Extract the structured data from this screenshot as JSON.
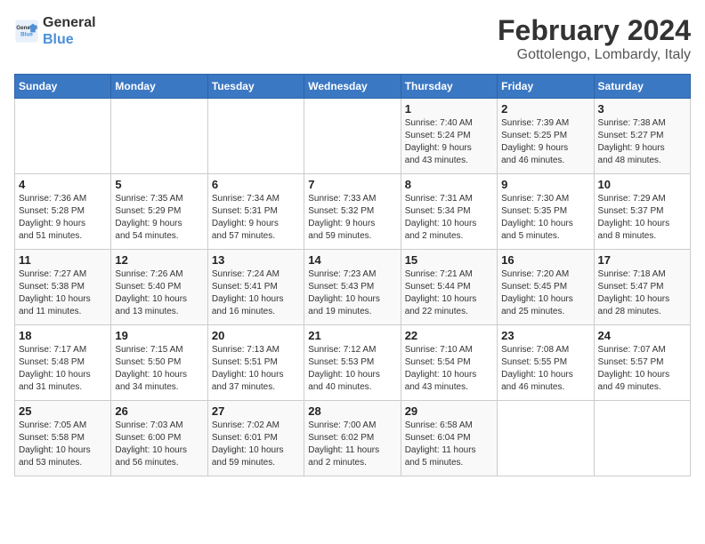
{
  "logo": {
    "line1": "General",
    "line2": "Blue"
  },
  "title": "February 2024",
  "location": "Gottolengo, Lombardy, Italy",
  "days_of_week": [
    "Sunday",
    "Monday",
    "Tuesday",
    "Wednesday",
    "Thursday",
    "Friday",
    "Saturday"
  ],
  "weeks": [
    [
      {
        "day": "",
        "info": ""
      },
      {
        "day": "",
        "info": ""
      },
      {
        "day": "",
        "info": ""
      },
      {
        "day": "",
        "info": ""
      },
      {
        "day": "1",
        "info": "Sunrise: 7:40 AM\nSunset: 5:24 PM\nDaylight: 9 hours\nand 43 minutes."
      },
      {
        "day": "2",
        "info": "Sunrise: 7:39 AM\nSunset: 5:25 PM\nDaylight: 9 hours\nand 46 minutes."
      },
      {
        "day": "3",
        "info": "Sunrise: 7:38 AM\nSunset: 5:27 PM\nDaylight: 9 hours\nand 48 minutes."
      }
    ],
    [
      {
        "day": "4",
        "info": "Sunrise: 7:36 AM\nSunset: 5:28 PM\nDaylight: 9 hours\nand 51 minutes."
      },
      {
        "day": "5",
        "info": "Sunrise: 7:35 AM\nSunset: 5:29 PM\nDaylight: 9 hours\nand 54 minutes."
      },
      {
        "day": "6",
        "info": "Sunrise: 7:34 AM\nSunset: 5:31 PM\nDaylight: 9 hours\nand 57 minutes."
      },
      {
        "day": "7",
        "info": "Sunrise: 7:33 AM\nSunset: 5:32 PM\nDaylight: 9 hours\nand 59 minutes."
      },
      {
        "day": "8",
        "info": "Sunrise: 7:31 AM\nSunset: 5:34 PM\nDaylight: 10 hours\nand 2 minutes."
      },
      {
        "day": "9",
        "info": "Sunrise: 7:30 AM\nSunset: 5:35 PM\nDaylight: 10 hours\nand 5 minutes."
      },
      {
        "day": "10",
        "info": "Sunrise: 7:29 AM\nSunset: 5:37 PM\nDaylight: 10 hours\nand 8 minutes."
      }
    ],
    [
      {
        "day": "11",
        "info": "Sunrise: 7:27 AM\nSunset: 5:38 PM\nDaylight: 10 hours\nand 11 minutes."
      },
      {
        "day": "12",
        "info": "Sunrise: 7:26 AM\nSunset: 5:40 PM\nDaylight: 10 hours\nand 13 minutes."
      },
      {
        "day": "13",
        "info": "Sunrise: 7:24 AM\nSunset: 5:41 PM\nDaylight: 10 hours\nand 16 minutes."
      },
      {
        "day": "14",
        "info": "Sunrise: 7:23 AM\nSunset: 5:43 PM\nDaylight: 10 hours\nand 19 minutes."
      },
      {
        "day": "15",
        "info": "Sunrise: 7:21 AM\nSunset: 5:44 PM\nDaylight: 10 hours\nand 22 minutes."
      },
      {
        "day": "16",
        "info": "Sunrise: 7:20 AM\nSunset: 5:45 PM\nDaylight: 10 hours\nand 25 minutes."
      },
      {
        "day": "17",
        "info": "Sunrise: 7:18 AM\nSunset: 5:47 PM\nDaylight: 10 hours\nand 28 minutes."
      }
    ],
    [
      {
        "day": "18",
        "info": "Sunrise: 7:17 AM\nSunset: 5:48 PM\nDaylight: 10 hours\nand 31 minutes."
      },
      {
        "day": "19",
        "info": "Sunrise: 7:15 AM\nSunset: 5:50 PM\nDaylight: 10 hours\nand 34 minutes."
      },
      {
        "day": "20",
        "info": "Sunrise: 7:13 AM\nSunset: 5:51 PM\nDaylight: 10 hours\nand 37 minutes."
      },
      {
        "day": "21",
        "info": "Sunrise: 7:12 AM\nSunset: 5:53 PM\nDaylight: 10 hours\nand 40 minutes."
      },
      {
        "day": "22",
        "info": "Sunrise: 7:10 AM\nSunset: 5:54 PM\nDaylight: 10 hours\nand 43 minutes."
      },
      {
        "day": "23",
        "info": "Sunrise: 7:08 AM\nSunset: 5:55 PM\nDaylight: 10 hours\nand 46 minutes."
      },
      {
        "day": "24",
        "info": "Sunrise: 7:07 AM\nSunset: 5:57 PM\nDaylight: 10 hours\nand 49 minutes."
      }
    ],
    [
      {
        "day": "25",
        "info": "Sunrise: 7:05 AM\nSunset: 5:58 PM\nDaylight: 10 hours\nand 53 minutes."
      },
      {
        "day": "26",
        "info": "Sunrise: 7:03 AM\nSunset: 6:00 PM\nDaylight: 10 hours\nand 56 minutes."
      },
      {
        "day": "27",
        "info": "Sunrise: 7:02 AM\nSunset: 6:01 PM\nDaylight: 10 hours\nand 59 minutes."
      },
      {
        "day": "28",
        "info": "Sunrise: 7:00 AM\nSunset: 6:02 PM\nDaylight: 11 hours\nand 2 minutes."
      },
      {
        "day": "29",
        "info": "Sunrise: 6:58 AM\nSunset: 6:04 PM\nDaylight: 11 hours\nand 5 minutes."
      },
      {
        "day": "",
        "info": ""
      },
      {
        "day": "",
        "info": ""
      }
    ]
  ]
}
